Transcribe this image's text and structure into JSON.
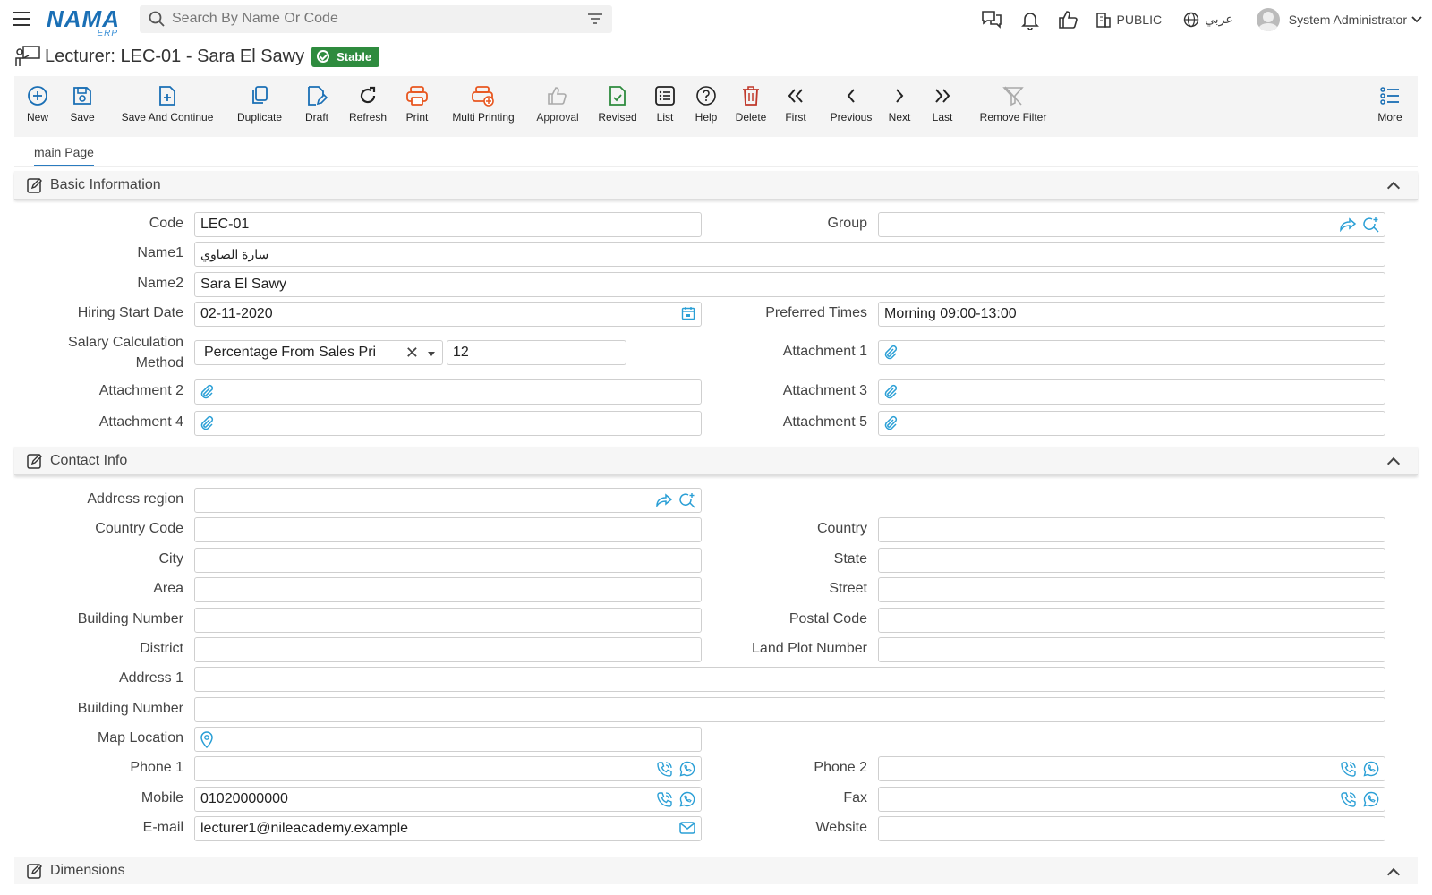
{
  "app": {
    "logo": "NAMA",
    "logo_sub": "ERP"
  },
  "search": {
    "placeholder": "Search By Name Or Code"
  },
  "top": {
    "branch": "PUBLIC",
    "language": "عربي",
    "user": "System Administrator"
  },
  "page": {
    "title": "Lecturer: LEC-01 - Sara El Sawy",
    "status": "Stable"
  },
  "toolbar": {
    "new": "New",
    "save": "Save",
    "save_continue": "Save And Continue",
    "duplicate": "Duplicate",
    "draft": "Draft",
    "refresh": "Refresh",
    "print": "Print",
    "multi_printing": "Multi Printing",
    "approval": "Approval",
    "revised": "Revised",
    "list": "List",
    "help": "Help",
    "delete": "Delete",
    "first": "First",
    "previous": "Previous",
    "next": "Next",
    "last": "Last",
    "remove_filter": "Remove Filter",
    "more": "More"
  },
  "tabs": {
    "main": "main Page"
  },
  "basic": {
    "title": "Basic Information",
    "code_label": "Code",
    "code": "LEC-01",
    "group_label": "Group",
    "group": "",
    "name1_label": "Name1",
    "name1": "سارة الصاوي",
    "name2_label": "Name2",
    "name2": "Sara El Sawy",
    "hiring_label": "Hiring Start Date",
    "hiring": "02-11-2020",
    "preferred_label": "Preferred Times",
    "preferred": "Morning 09:00-13:00",
    "salary_label_1": "Salary Calculation",
    "salary_label_2": "Method",
    "salary_method": "Percentage From Sales Pri",
    "salary_value": "12",
    "att1_label": "Attachment 1",
    "att2_label": "Attachment 2",
    "att3_label": "Attachment 3",
    "att4_label": "Attachment 4",
    "att5_label": "Attachment 5"
  },
  "contact": {
    "title": "Contact Info",
    "region_label": "Address region",
    "country_code_label": "Country Code",
    "country_label": "Country",
    "city_label": "City",
    "state_label": "State",
    "area_label": "Area",
    "street_label": "Street",
    "building_label": "Building Number",
    "postal_label": "Postal Code",
    "district_label": "District",
    "plot_label": "Land Plot Number",
    "address1_label": "Address 1",
    "building2_label": "Building Number",
    "map_label": "Map Location",
    "phone1_label": "Phone 1",
    "phone2_label": "Phone 2",
    "mobile_label": "Mobile",
    "mobile": "01020000000",
    "fax_label": "Fax",
    "email_label": "E-mail",
    "email": "lecturer1@nileacademy.example",
    "website_label": "Website"
  },
  "dimensions": {
    "title": "Dimensions"
  },
  "colors": {
    "accent": "#1a6fb5",
    "status": "#2e8b3e",
    "print": "#e8561f",
    "delete": "#c0392b",
    "icon_blue": "#2a9fd6"
  }
}
